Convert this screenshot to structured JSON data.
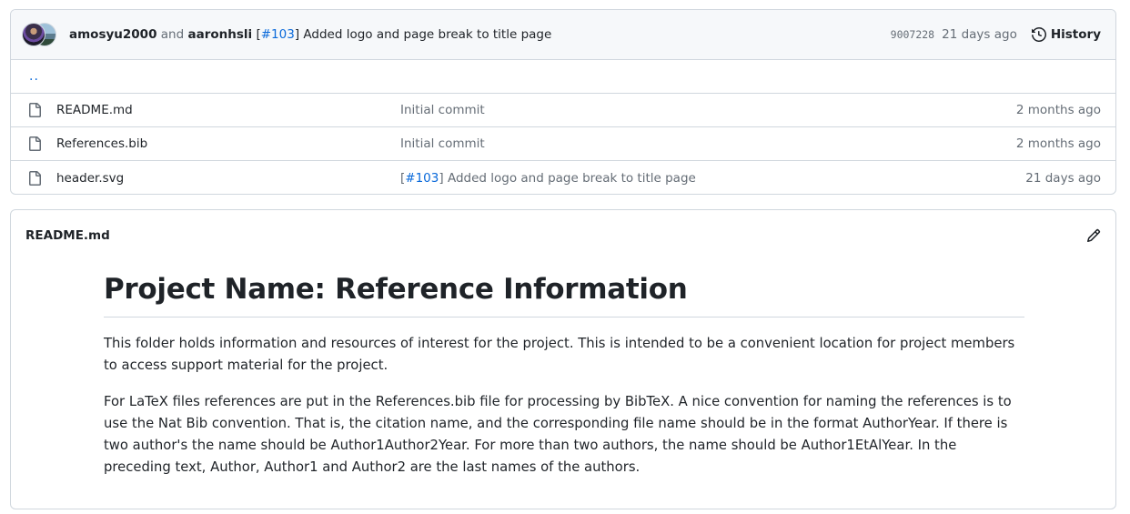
{
  "commit": {
    "author1": "amosyu2000",
    "connector": "and",
    "author2": "aaronhsli",
    "bracket_open": "[",
    "issue_ref": "#103",
    "bracket_close": "]",
    "message": " Added logo and page break to title page",
    "sha": "9007228",
    "age": "21 days ago",
    "history_label": "History"
  },
  "parent_dir": "..",
  "files": [
    {
      "name": "README.md",
      "message": "Initial commit",
      "issue_ref": "",
      "age": "2 months ago"
    },
    {
      "name": "References.bib",
      "message": "Initial commit",
      "issue_ref": "",
      "age": "2 months ago"
    },
    {
      "name": "header.svg",
      "message": " Added logo and page break to title page",
      "issue_ref": "#103",
      "age": "21 days ago"
    }
  ],
  "readme": {
    "filename": "README.md",
    "heading": "Project Name: Reference Information",
    "paragraphs": [
      "This folder holds information and resources of interest for the project. This is intended to be a convenient location for project members to access support material for the project.",
      "For LaTeX files references are put in the References.bib file for processing by BibTeX. A nice convention for naming the references is to use the Nat Bib convention. That is, the citation name, and the corresponding file name should be in the format AuthorYear. If there is two author's the name should be Author1Author2Year. For more than two authors, the name should be Author1EtAlYear. In the preceding text, Author, Author1 and Author2 are the last names of the authors."
    ]
  },
  "icons": {
    "history": "history-icon",
    "file": "file-icon",
    "edit": "pencil-icon"
  },
  "colors": {
    "link": "#0969da",
    "muted": "#656d76",
    "border": "#d0d7de",
    "header_bg": "#f6f8fa"
  }
}
